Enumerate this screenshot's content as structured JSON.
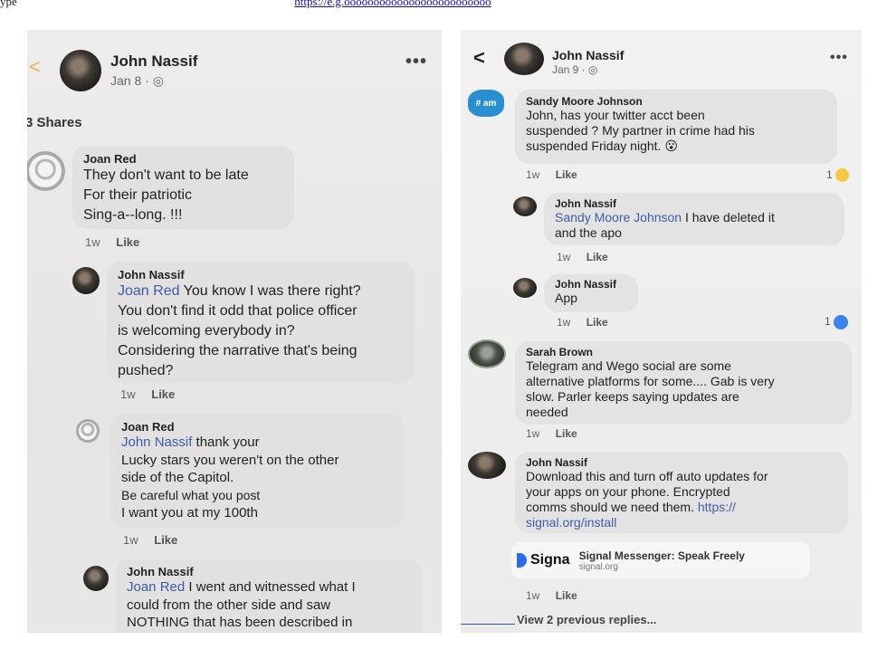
{
  "caption": {
    "text": "ype",
    "link": "https://e.g.ooooooooooooooooooooooooo"
  },
  "left": {
    "header": {
      "back": "<",
      "name": "John Nassif",
      "date": "Jan 8 · ",
      "globe": "◎",
      "more": "•••"
    },
    "shares": "3 Shares",
    "comments": [
      {
        "name": "Joan Red",
        "lines": [
          "They don't want to be late",
          "For their patriotic",
          "Sing-a--long. !!!"
        ],
        "time": "1w",
        "like": "Like"
      },
      {
        "name": "John Nassif",
        "mention": "Joan Red",
        "lines": [
          " You know I was there right?",
          "You don't find it odd that police officer",
          "is welcoming everybody in?",
          "Considering the narrative that's being",
          "pushed?"
        ],
        "time": "1w",
        "like": "Like"
      },
      {
        "name": "Joan Red",
        "mention": "John Nassif",
        "lines": [
          " thank your",
          "Lucky stars you weren't on the other",
          "side of the Capitol.",
          "Be careful what you post",
          "I want you at my 100th"
        ],
        "time": "1w",
        "like": "Like"
      },
      {
        "name": "John Nassif",
        "mention": "Joan Red",
        "lines": [
          " I went and witnessed what I",
          "could from the other side and saw",
          "NOTHING that has been described in"
        ]
      }
    ]
  },
  "right": {
    "header": {
      "back": "<",
      "name": "John Nassif",
      "date": "Jan 9 · ",
      "globe": "◎",
      "more": "•••"
    },
    "comments": [
      {
        "avatar": "# am",
        "name": "Sandy Moore Johnson",
        "lines": [
          "John,  has your twitter acct been",
          "suspended ?   My partner in crime had his",
          "suspended Friday night. "
        ],
        "emoji": "😮",
        "time": "1w",
        "like": "Like",
        "count": "1"
      },
      {
        "name": "John Nassif",
        "mention": "Sandy Moore Johnson",
        "lines": [
          " I have deleted it",
          "and the apo"
        ],
        "time": "1w",
        "like": "Like"
      },
      {
        "name": "John Nassif",
        "lines": [
          "App"
        ],
        "time": "1w",
        "like": "Like",
        "count": "1"
      },
      {
        "name": "Sarah Brown",
        "lines": [
          "Telegram and Wego social are some",
          "alternative platforms for some.... Gab is very",
          "slow. Parler keeps saying updates are",
          "needed"
        ],
        "time": "1w",
        "like": "Like"
      },
      {
        "name": "John Nassif",
        "lines": [
          "Download this and turn off  auto updates for",
          "your apps on your phone. Encrypted",
          "comms should we need them. "
        ],
        "link1": "https://",
        "link2": "signal.org/install"
      }
    ],
    "card": {
      "logo": "Signa",
      "title": "Signal Messenger: Speak Freely",
      "domain": "signal.org"
    },
    "card_time": "1w",
    "card_like": "Like",
    "view_more": "View 2 previous replies..."
  }
}
